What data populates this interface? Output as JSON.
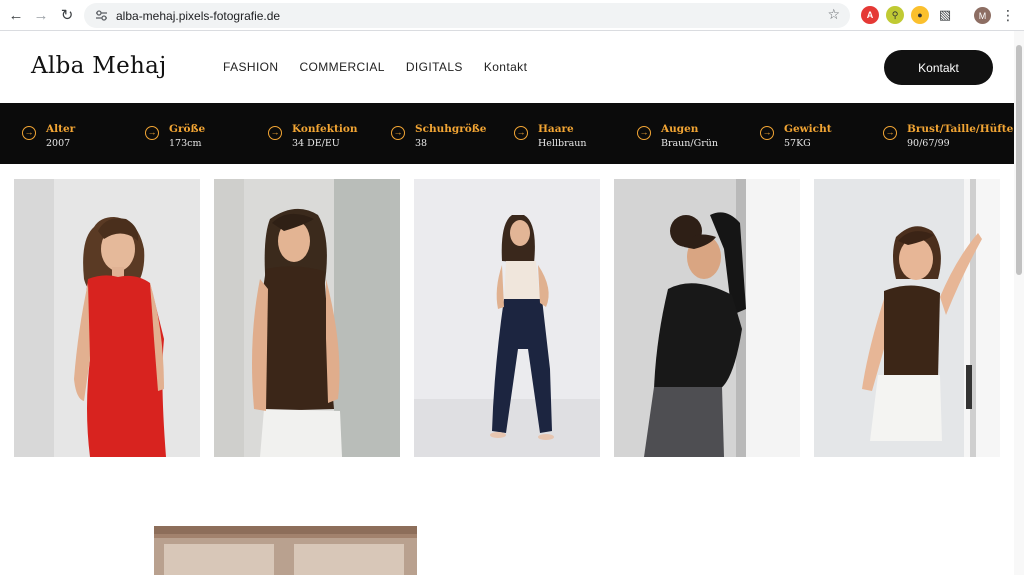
{
  "browser": {
    "url": "alba-mehaj.pixels-fotografie.de",
    "profile_initial": "M",
    "icons": [
      "back-icon",
      "forward-icon",
      "reload-icon",
      "site-settings-icon",
      "star-icon",
      "extensions-icon",
      "menu-icon"
    ]
  },
  "header": {
    "brand": "Alba Mehaj",
    "nav": [
      {
        "label": "FASHION"
      },
      {
        "label": "COMMERCIAL"
      },
      {
        "label": "DIGITALS"
      },
      {
        "label": "Kontakt"
      }
    ],
    "cta_label": "Kontakt"
  },
  "stats": [
    {
      "label": "Alter",
      "value": "2007"
    },
    {
      "label": "Größe",
      "value": "173cm"
    },
    {
      "label": "Konfektion",
      "value": "34 DE/EU"
    },
    {
      "label": "Schuhgröße",
      "value": "38"
    },
    {
      "label": "Haare",
      "value": "Hellbraun"
    },
    {
      "label": "Augen",
      "value": "Braun/Grün"
    },
    {
      "label": "Gewicht",
      "value": "57KG"
    },
    {
      "label": "Brust/Taille/Hüfte",
      "value": "90/67/99"
    }
  ],
  "colors": {
    "accent": "#f2a534",
    "stats_bg": "#0b0b0b",
    "cta_bg": "#111111"
  },
  "gallery": [
    {
      "outfit": "red-dress",
      "bg": "#e4e4e4"
    },
    {
      "outfit": "brown-halter-white-skirt",
      "bg": "#d7d7d5"
    },
    {
      "outfit": "cream-top-navy-pants",
      "bg": "#e9e9ec"
    },
    {
      "outfit": "black-top-grey-jeans",
      "bg": "#dcdcdc"
    },
    {
      "outfit": "brown-halter-white-skirt",
      "bg": "#e2e5e7"
    }
  ]
}
